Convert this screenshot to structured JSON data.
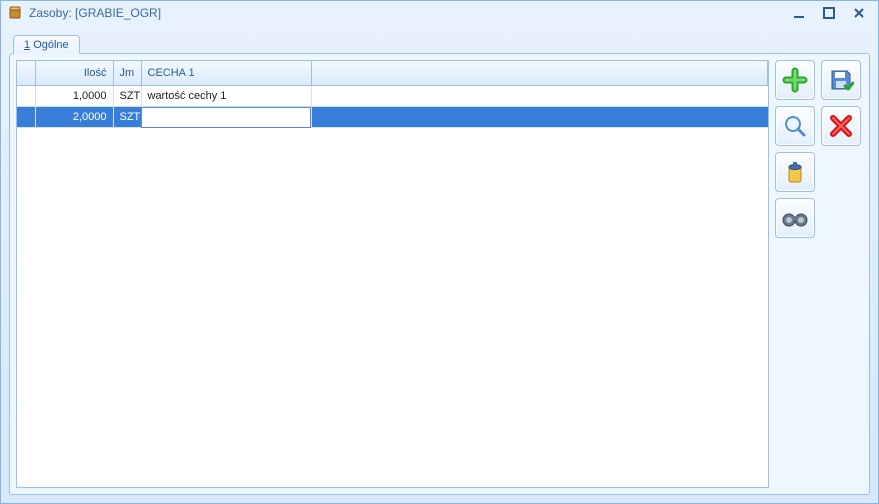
{
  "window": {
    "title": "Zasoby: [GRABIE_OGR]"
  },
  "tabs": [
    {
      "prefix": "1",
      "label": "Ogólne"
    }
  ],
  "grid": {
    "columns": {
      "ilosc": "Ilość",
      "jm": "Jm",
      "cecha1": "CECHA 1"
    },
    "rows": [
      {
        "ilosc": "1,0000",
        "jm": "SZT",
        "cecha1": "wartość cechy 1",
        "selected": false
      },
      {
        "ilosc": "2,0000",
        "jm": "SZT",
        "cecha1": "",
        "selected": true
      }
    ]
  },
  "toolbar": {
    "add": "add",
    "search": "search",
    "bin": "bin",
    "binoculars": "binoculars",
    "save": "save",
    "cancel": "cancel"
  }
}
